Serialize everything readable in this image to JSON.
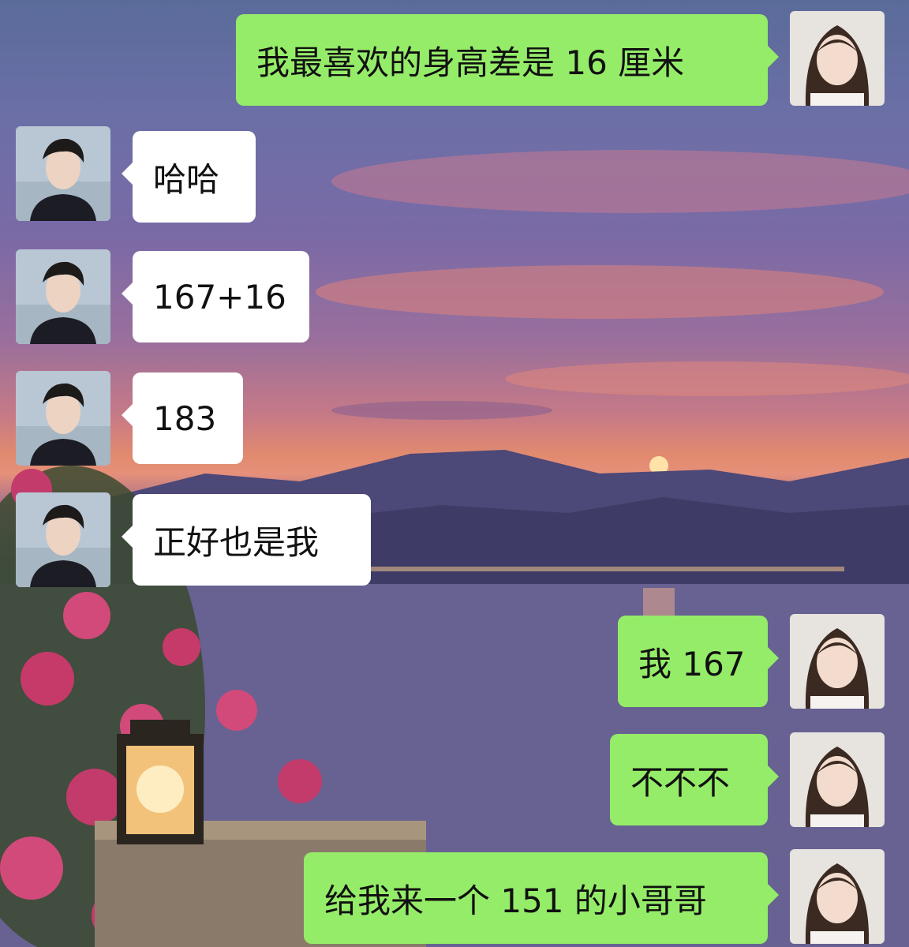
{
  "chat": {
    "messages": [
      {
        "side": "right",
        "sender": "girl",
        "text": "我最喜欢的身高差是 16 厘米"
      },
      {
        "side": "left",
        "sender": "boy",
        "text": "哈哈"
      },
      {
        "side": "left",
        "sender": "boy",
        "text": "167+16"
      },
      {
        "side": "left",
        "sender": "boy",
        "text": "183"
      },
      {
        "side": "left",
        "sender": "boy",
        "text": "正好也是我"
      },
      {
        "side": "right",
        "sender": "girl",
        "text": "我 167"
      },
      {
        "side": "right",
        "sender": "girl",
        "text": "不不不"
      },
      {
        "side": "right",
        "sender": "girl",
        "text": "给我来一个 151 的小哥哥"
      }
    ]
  },
  "colors": {
    "outgoing_bubble": "#95ec69",
    "incoming_bubble": "#ffffff"
  }
}
